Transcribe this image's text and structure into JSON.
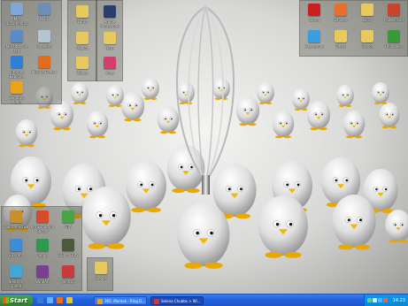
{
  "desktop": {
    "icons_left_top": [
      {
        "label": "Mis documentos",
        "icon": "folder-documents-icon",
        "color": "#7fa7d8"
      },
      {
        "label": "Mi PC",
        "icon": "computer-icon",
        "color": "#6e8fb5"
      },
      {
        "label": "Mis sitios de red",
        "icon": "network-icon",
        "color": "#5b8cc8"
      },
      {
        "label": "Papelera",
        "icon": "recycle-bin-icon",
        "color": "#b5c4d1"
      },
      {
        "label": "Internet Explorer",
        "icon": "ie-icon",
        "color": "#2f7fd8"
      },
      {
        "label": "Mozilla Firefox",
        "icon": "firefox-icon",
        "color": "#e36b1c"
      },
      {
        "label": "Windows Media",
        "icon": "media-player-icon",
        "color": "#e8a21b"
      }
    ],
    "icons_col2": [
      {
        "label": "Fotos",
        "icon": "folder-icon",
        "color": "#e8c95e"
      },
      {
        "label": "Música",
        "icon": "folder-icon",
        "color": "#e8c95e"
      },
      {
        "label": "Videos",
        "icon": "folder-icon",
        "color": "#e8c95e"
      }
    ],
    "icons_col3": [
      {
        "label": "Adobe Photoshop",
        "icon": "photoshop-icon",
        "color": "#2a3f6b"
      },
      {
        "label": "Nero",
        "icon": "folder-icon",
        "color": "#e8c95e"
      },
      {
        "label": "Ares",
        "icon": "ares-icon",
        "color": "#d23f6c"
      }
    ],
    "icons_right": [
      {
        "label": "Opera",
        "icon": "opera-icon",
        "color": "#cc1f1f"
      },
      {
        "label": "Drivers",
        "icon": "drivers-icon",
        "color": "#e86f2b"
      },
      {
        "label": "Docs",
        "icon": "folder-icon",
        "color": "#e8c95e"
      },
      {
        "label": "PowerPoint",
        "icon": "powerpoint-icon",
        "color": "#c8452b"
      },
      {
        "label": "Messenger",
        "icon": "messenger-icon",
        "color": "#3a9de0"
      },
      {
        "label": "Otros",
        "icon": "folder-icon",
        "color": "#e8c95e"
      },
      {
        "label": "Cursos",
        "icon": "folder-icon",
        "color": "#e8c95e"
      },
      {
        "label": "Utilidades",
        "icon": "utilities-icon",
        "color": "#3a9a3a"
      }
    ],
    "icons_bottom_left": [
      {
        "label": "Counter-Strike",
        "icon": "cs-icon",
        "color": "#c8902b"
      },
      {
        "label": "Pro Evolution Soccer",
        "icon": "pes-icon",
        "color": "#d94a2a"
      },
      {
        "label": "GTA",
        "icon": "gta-icon",
        "color": "#47a447"
      },
      {
        "label": "uTorrent",
        "icon": "utorrent-icon",
        "color": "#3c8dd6"
      },
      {
        "label": "Juego",
        "icon": "game-icon",
        "color": "#2f9a4f"
      },
      {
        "label": "Call of Duty",
        "icon": "cod-icon",
        "color": "#4a5a3a"
      },
      {
        "label": "Need for Speed",
        "icon": "nfs-icon",
        "color": "#3fa8d8"
      },
      {
        "label": "WinRAR",
        "icon": "winrar-icon",
        "color": "#7b3f8f"
      },
      {
        "label": "Ventrilo",
        "icon": "ventrilo-icon",
        "color": "#c93b3b"
      }
    ],
    "icons_games": [
      {
        "label": "Juegos",
        "icon": "folder-icon",
        "color": "#e8c95e"
      }
    ]
  },
  "taskbar": {
    "start_label": "Start",
    "quick_launch": [
      {
        "icon": "show-desktop-icon",
        "color": "#3d7ad8"
      },
      {
        "icon": "ie-quick-icon",
        "color": "#5fb3ee"
      },
      {
        "icon": "firefox-quick-icon",
        "color": "#e8711c"
      },
      {
        "icon": "media-quick-icon",
        "color": "#e7c13a"
      }
    ],
    "tasks": [
      {
        "label": "365: Mumok - Ring D...",
        "icon": "winamp-icon",
        "color": "#e8a21b"
      },
      {
        "label": "Selena Chubbs > Wi...",
        "icon": "browser-icon",
        "color": "#d03636"
      }
    ],
    "tray_icons": [
      {
        "icon": "network-tray-icon",
        "color": "#6fd06f"
      },
      {
        "icon": "volume-tray-icon",
        "color": "#e6e6e6"
      },
      {
        "icon": "messenger-tray-icon",
        "color": "#3ac0ff"
      },
      {
        "icon": "antivirus-tray-icon",
        "color": "#ff5a3a"
      }
    ],
    "clock": "14:23"
  }
}
